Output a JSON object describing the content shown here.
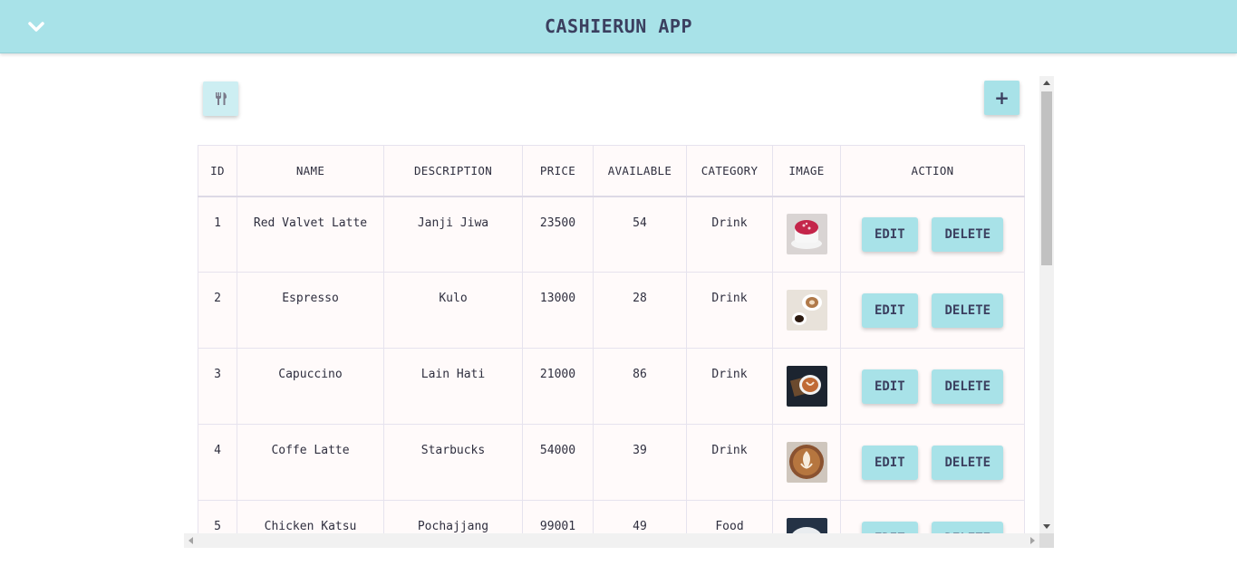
{
  "app": {
    "title": "CASHIERUN APP"
  },
  "header": {
    "toggle_icon": "chevron-down-icon"
  },
  "toolbar": {
    "menu_icon": "utensils-icon",
    "add_label": "+"
  },
  "table": {
    "columns": [
      "ID",
      "NAME",
      "DESCRIPTION",
      "PRICE",
      "AVAILABLE",
      "CATEGORY",
      "IMAGE",
      "ACTION"
    ],
    "rows": [
      {
        "id": "1",
        "name": "Red Valvet Latte",
        "description": "Janji Jiwa",
        "price": "23500",
        "available": "54",
        "category": "Drink"
      },
      {
        "id": "2",
        "name": "Espresso",
        "description": "Kulo",
        "price": "13000",
        "available": "28",
        "category": "Drink"
      },
      {
        "id": "3",
        "name": "Capuccino",
        "description": "Lain Hati",
        "price": "21000",
        "available": "86",
        "category": "Drink"
      },
      {
        "id": "4",
        "name": "Coffe Latte",
        "description": "Starbucks",
        "price": "54000",
        "available": "39",
        "category": "Drink"
      },
      {
        "id": "5",
        "name": "Chicken Katsu",
        "description": "Pochajjang",
        "price": "99001",
        "available": "49",
        "category": "Food"
      }
    ],
    "edit_label": "EDIT",
    "delete_label": "DELETE"
  },
  "colors": {
    "accent": "#a8e2e8",
    "text": "#3b3f5f",
    "row_bg": "#fffafa"
  }
}
